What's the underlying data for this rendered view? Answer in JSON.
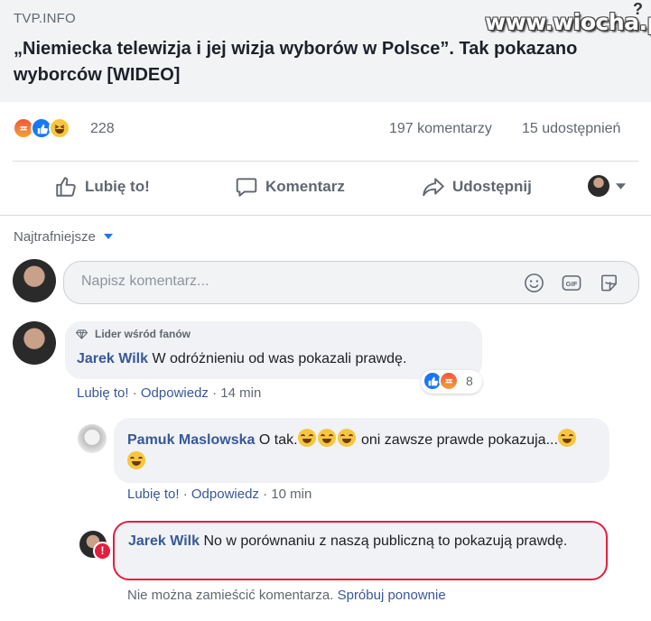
{
  "header": {
    "source": "TVP.INFO",
    "title": "„Niemiecka telewizja i jej wizja wyborów w Polsce”. Tak pokazano wyborców [WIDEO]",
    "watermark": "www.wiocha.pl",
    "corner_mark": "?"
  },
  "stats": {
    "reaction_count": "228",
    "comments": "197 komentarzy",
    "shares": "15 udostępnień"
  },
  "actions": {
    "like": "Lubię to!",
    "comment": "Komentarz",
    "share": "Udostępnij"
  },
  "sort": {
    "label": "Najtrafniejsze"
  },
  "composer": {
    "placeholder": "Napisz komentarz..."
  },
  "comments": [
    {
      "badge": "Lider wśród fanów",
      "author": "Jarek Wilk",
      "text": "W odróżnieniu od was pokazali prawdę.",
      "like": "Lubię to!",
      "reply": "Odpowiedz",
      "time": "14 min",
      "reaction_count": "8"
    }
  ],
  "replies": [
    {
      "author": "Pamuk Maslowska",
      "text_a": "O tak.",
      "text_b": "oni zawsze prawde pokazuja...",
      "like": "Lubię to!",
      "reply": "Odpowiedz",
      "time": "10 min"
    },
    {
      "author": "Jarek Wilk",
      "text": "No w porównaniu z naszą publiczną to pokazują prawdę.",
      "error": "Nie można zamieścić komentarza.",
      "retry": "Spróbuj ponownie"
    }
  ],
  "colors": {
    "link": "#385898",
    "error_border": "#e41e3f",
    "like_blue": "#1877f2"
  }
}
